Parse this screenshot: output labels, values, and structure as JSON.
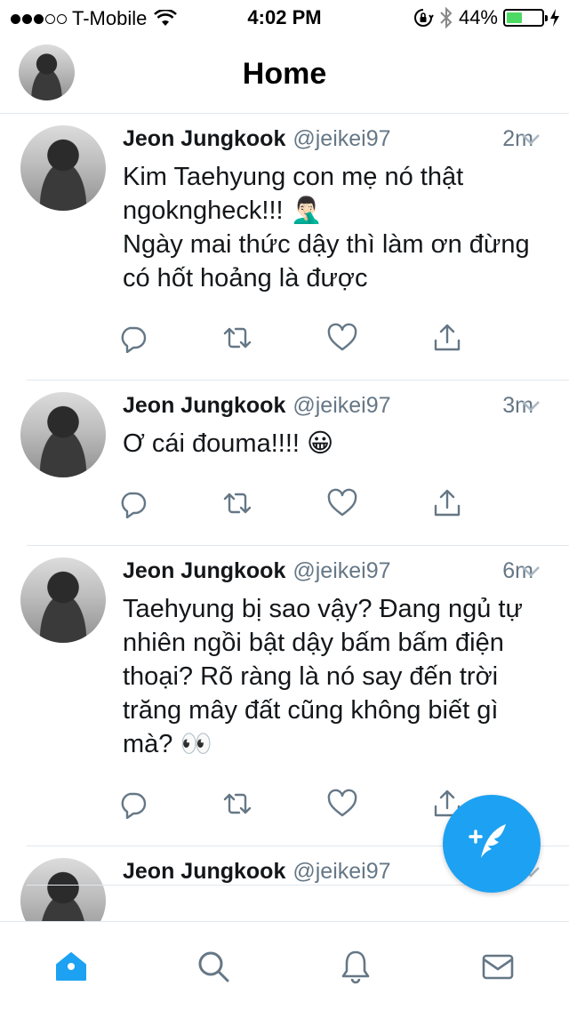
{
  "status_bar": {
    "carrier": "T-Mobile",
    "time": "4:02 PM",
    "battery": "44%",
    "battery_level": 0.44,
    "signal_bars_filled": 3,
    "signal_bars_total": 5
  },
  "header": {
    "title": "Home"
  },
  "tweets": [
    {
      "name": "Jeon Jungkook",
      "handle": "@jeikei97",
      "time": "2m",
      "text": "Kim Taehyung con mẹ nó thật ngokngheck!!! 🤦🏻‍♂️\nNgày mai thức dậy thì làm ơn đừng có hốt hoảng là được"
    },
    {
      "name": "Jeon Jungkook",
      "handle": "@jeikei97",
      "time": "3m",
      "text": "Ơ cái đouma!!!! 😀"
    },
    {
      "name": "Jeon Jungkook",
      "handle": "@jeikei97",
      "time": "6m",
      "text": "Taehyung bị sao vậy? Đang ngủ tự nhiên ngồi bật dậy bấm bấm điện thoại? Rõ ràng là nó say đến trời trăng mây đất cũng không biết gì mà? 👀"
    },
    {
      "name": "Jeon Jungkook",
      "handle": "@jeikei97",
      "time": "",
      "text": ""
    }
  ],
  "colors": {
    "accent": "#1da1f2",
    "secondary_text": "#657786",
    "icon": "#657786",
    "divider": "#e1e8ed"
  },
  "icons": {
    "actions": [
      "reply-icon",
      "retweet-icon",
      "like-icon",
      "share-icon"
    ],
    "tabs": [
      "home-icon",
      "search-icon",
      "notifications-icon",
      "messages-icon"
    ],
    "compose": "compose-tweet-icon"
  }
}
